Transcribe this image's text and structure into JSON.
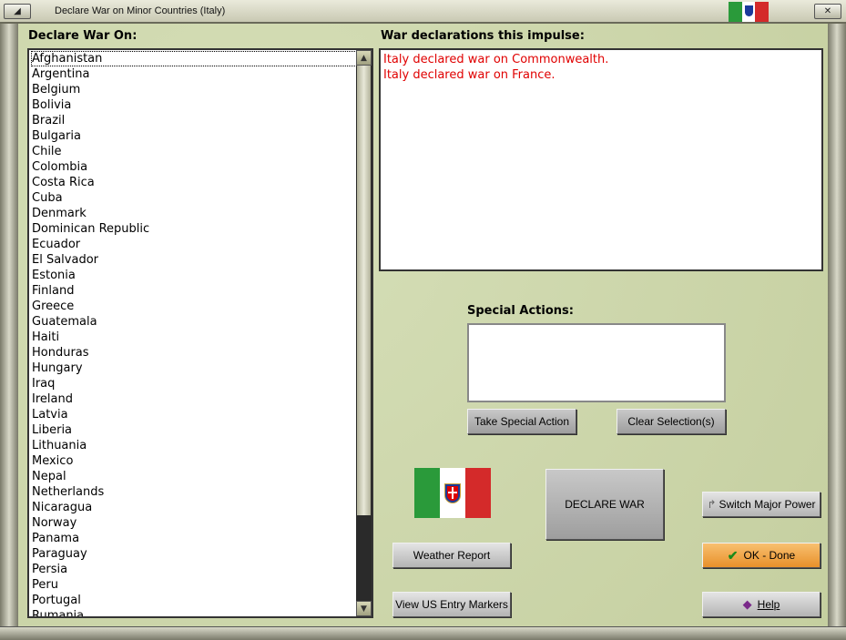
{
  "window": {
    "title": "Declare War on Minor Countries (Italy)",
    "minimize_icon": "triangle-up-icon",
    "close_icon": "close-x-icon"
  },
  "left_panel": {
    "heading": "Declare War On:",
    "countries": [
      "Afghanistan",
      "Argentina",
      "Belgium",
      "Bolivia",
      "Brazil",
      "Bulgaria",
      "Chile",
      "Colombia",
      "Costa Rica",
      "Cuba",
      "Denmark",
      "Dominican Republic",
      "Ecuador",
      "El Salvador",
      "Estonia",
      "Finland",
      "Greece",
      "Guatemala",
      "Haiti",
      "Honduras",
      "Hungary",
      "Iraq",
      "Ireland",
      "Latvia",
      "Liberia",
      "Lithuania",
      "Mexico",
      "Nepal",
      "Netherlands",
      "Nicaragua",
      "Norway",
      "Panama",
      "Paraguay",
      "Persia",
      "Peru",
      "Portugal",
      "Rumania"
    ],
    "selected": "Afghanistan"
  },
  "declarations": {
    "heading": "War declarations this impulse:",
    "lines": [
      "Italy declared war on Commonwealth.",
      "Italy declared war on France."
    ],
    "text_color": "#e00000"
  },
  "special_actions": {
    "heading": "Special Actions:",
    "take_label": "Take Special Action",
    "clear_label": "Clear Selection(s)"
  },
  "buttons": {
    "declare_war": "DECLARE WAR",
    "switch_major_power": "Switch Major Power",
    "weather_report": "Weather Report",
    "ok_done": "OK - Done",
    "view_us_entry": "View US Entry Markers",
    "help": "Help"
  },
  "flag": {
    "country": "Italy",
    "colors": [
      "#2a9a3a",
      "#ffffff",
      "#d42a2a"
    ]
  }
}
